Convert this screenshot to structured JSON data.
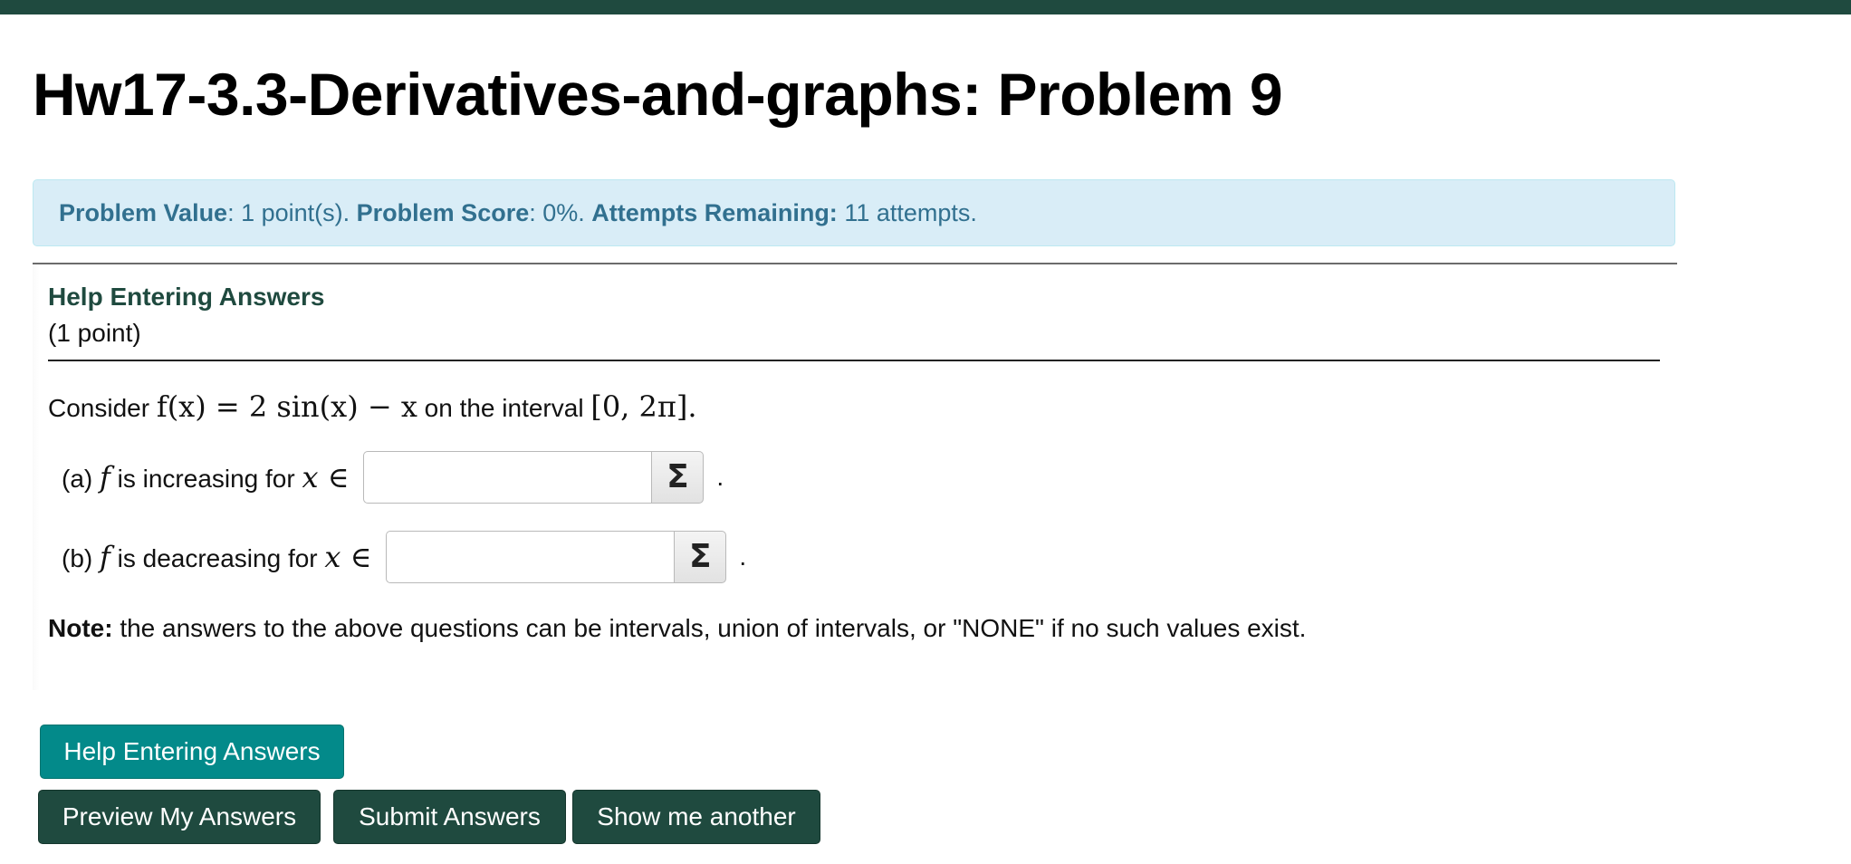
{
  "page": {
    "title": "Hw17-3.3-Derivatives-and-graphs: Problem 9"
  },
  "info": {
    "value_label": "Problem Value",
    "value_text": ": 1 point(s).",
    "score_label": "Problem Score",
    "score_text": ": 0%.",
    "attempts_label": "Attempts Remaining:",
    "attempts_text": " 11 attempts."
  },
  "problem": {
    "help_link": "Help Entering Answers",
    "points": "(1 point)",
    "intro_before": "Consider ",
    "intro_function": "f(x) = 2 sin(x) − x",
    "intro_middle": " on the interval ",
    "intro_interval": "[0, 2π]",
    "intro_after": ".",
    "part_a": {
      "prefix": "(a) ",
      "var": "f",
      "text": " is increasing for ",
      "set": "x ∈",
      "value": "",
      "suffix": "."
    },
    "part_b": {
      "prefix": "(b) ",
      "var": "f",
      "text": " is deacreasing for ",
      "set": "x ∈",
      "value": "",
      "suffix": "."
    },
    "equation_icon": "sigma-icon",
    "equation_glyph": "Σ",
    "note_label": "Note:",
    "note_text": " the answers to the above questions can be intervals, union of intervals, or \"NONE\" if no such values exist."
  },
  "buttons": {
    "help": "Help Entering Answers",
    "preview": "Preview My Answers",
    "submit": "Submit Answers",
    "another": "Show me another"
  },
  "colors": {
    "brand_dark": "#1f4a3f",
    "help_button": "#038a8a",
    "info_background": "#d9edf7",
    "info_text": "#31708f"
  }
}
